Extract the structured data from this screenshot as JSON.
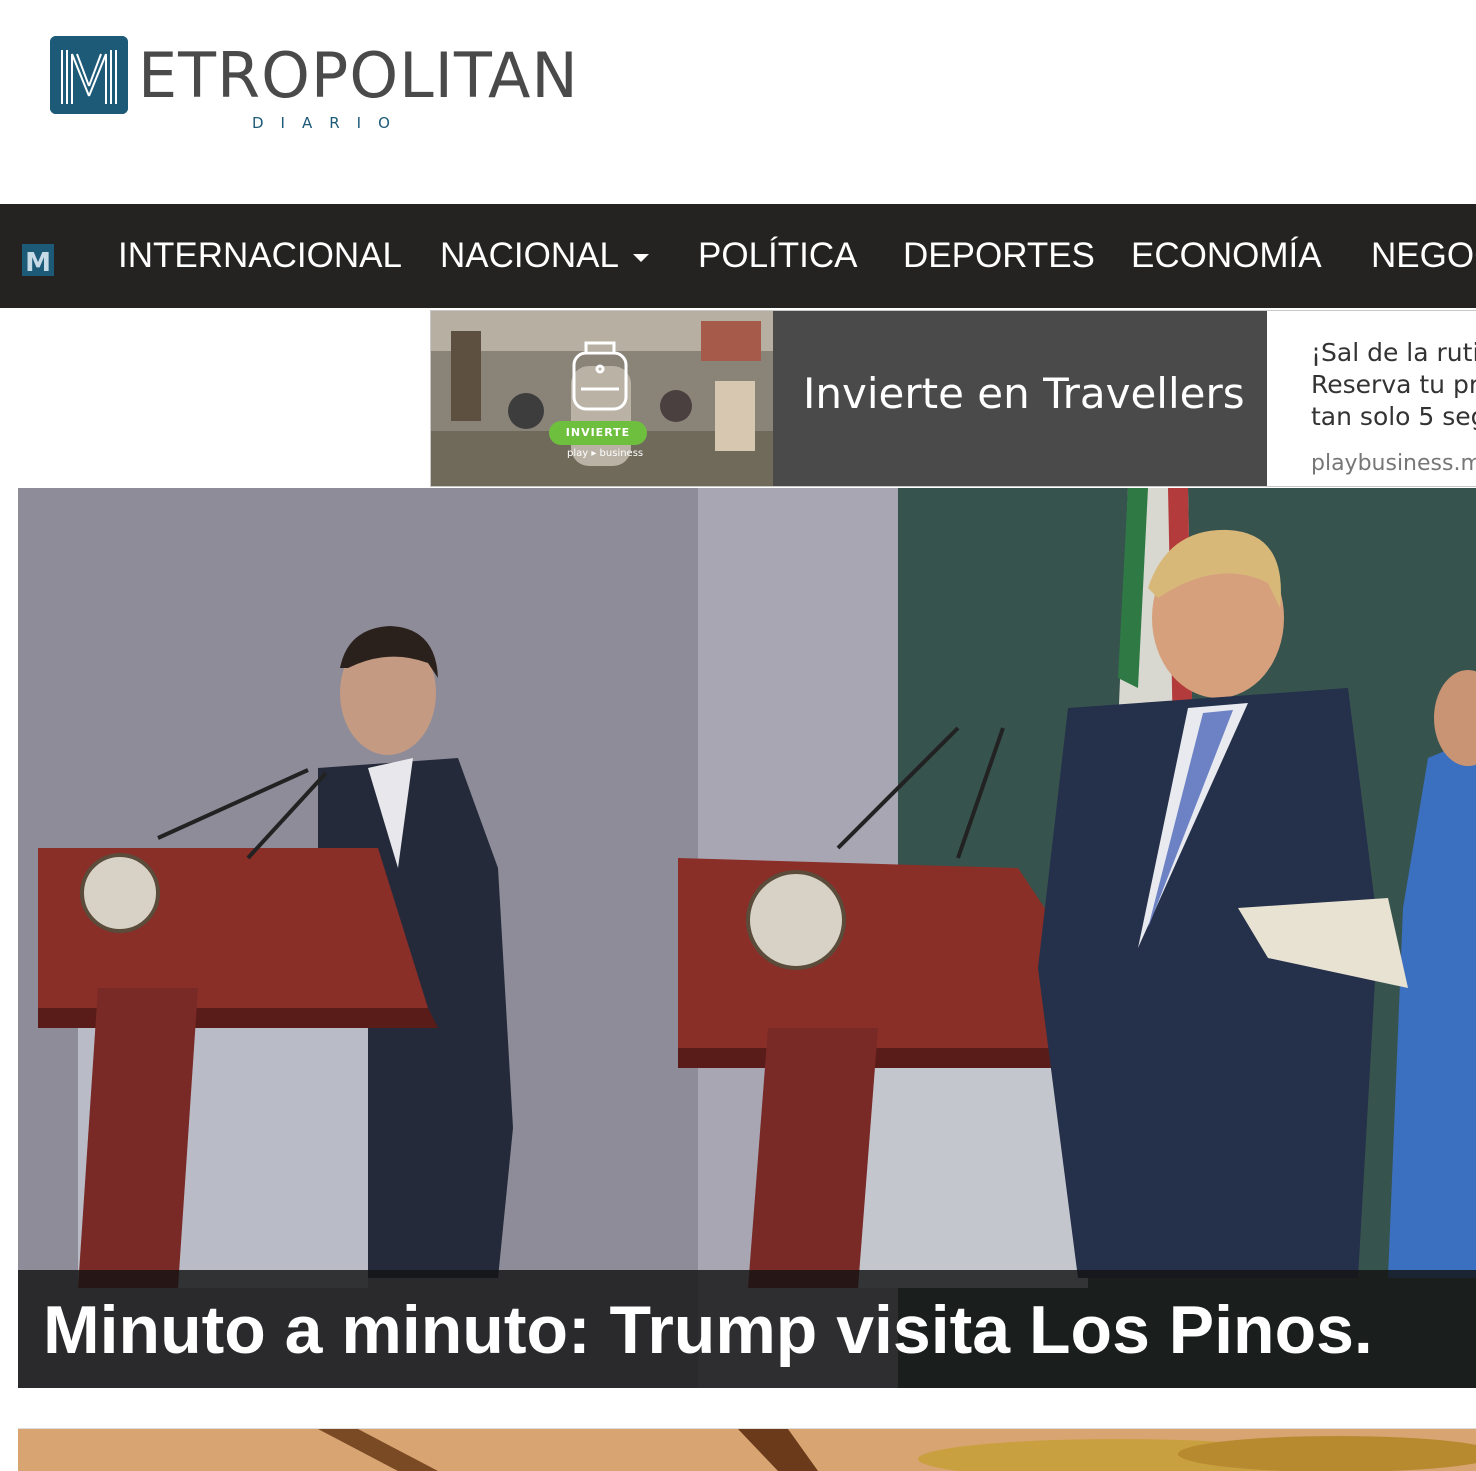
{
  "header": {
    "logo_word": "ETROPOLITAN",
    "logo_sub": "DIARIO",
    "logo_icon": "metropolitan-m-logo"
  },
  "nav": {
    "brand_icon": "metropolitan-m-icon",
    "items": [
      {
        "label": "INTERNACIONAL"
      },
      {
        "label": "NACIONAL",
        "has_dropdown": true
      },
      {
        "label": "POLÍTICA"
      },
      {
        "label": "DEPORTES"
      },
      {
        "label": "ECONOMÍA"
      },
      {
        "label": "NEGOC"
      }
    ]
  },
  "ad": {
    "badge": "INVIERTE",
    "small_brand": "play ▸ business",
    "headline": "Invierte en Travellers",
    "text_line1": "¡Sal de la rutir",
    "text_line2": "Reserva tu pro",
    "text_line3": "tan solo 5 seg",
    "domain": "playbusiness.mx"
  },
  "hero": {
    "title": "Minuto a minuto: Trump visita Los Pinos."
  },
  "colors": {
    "nav_bg": "#252222",
    "brand_blue": "#1c5a78",
    "ad_dark": "#4a4a4a",
    "badge_green": "#6fbf3f"
  }
}
